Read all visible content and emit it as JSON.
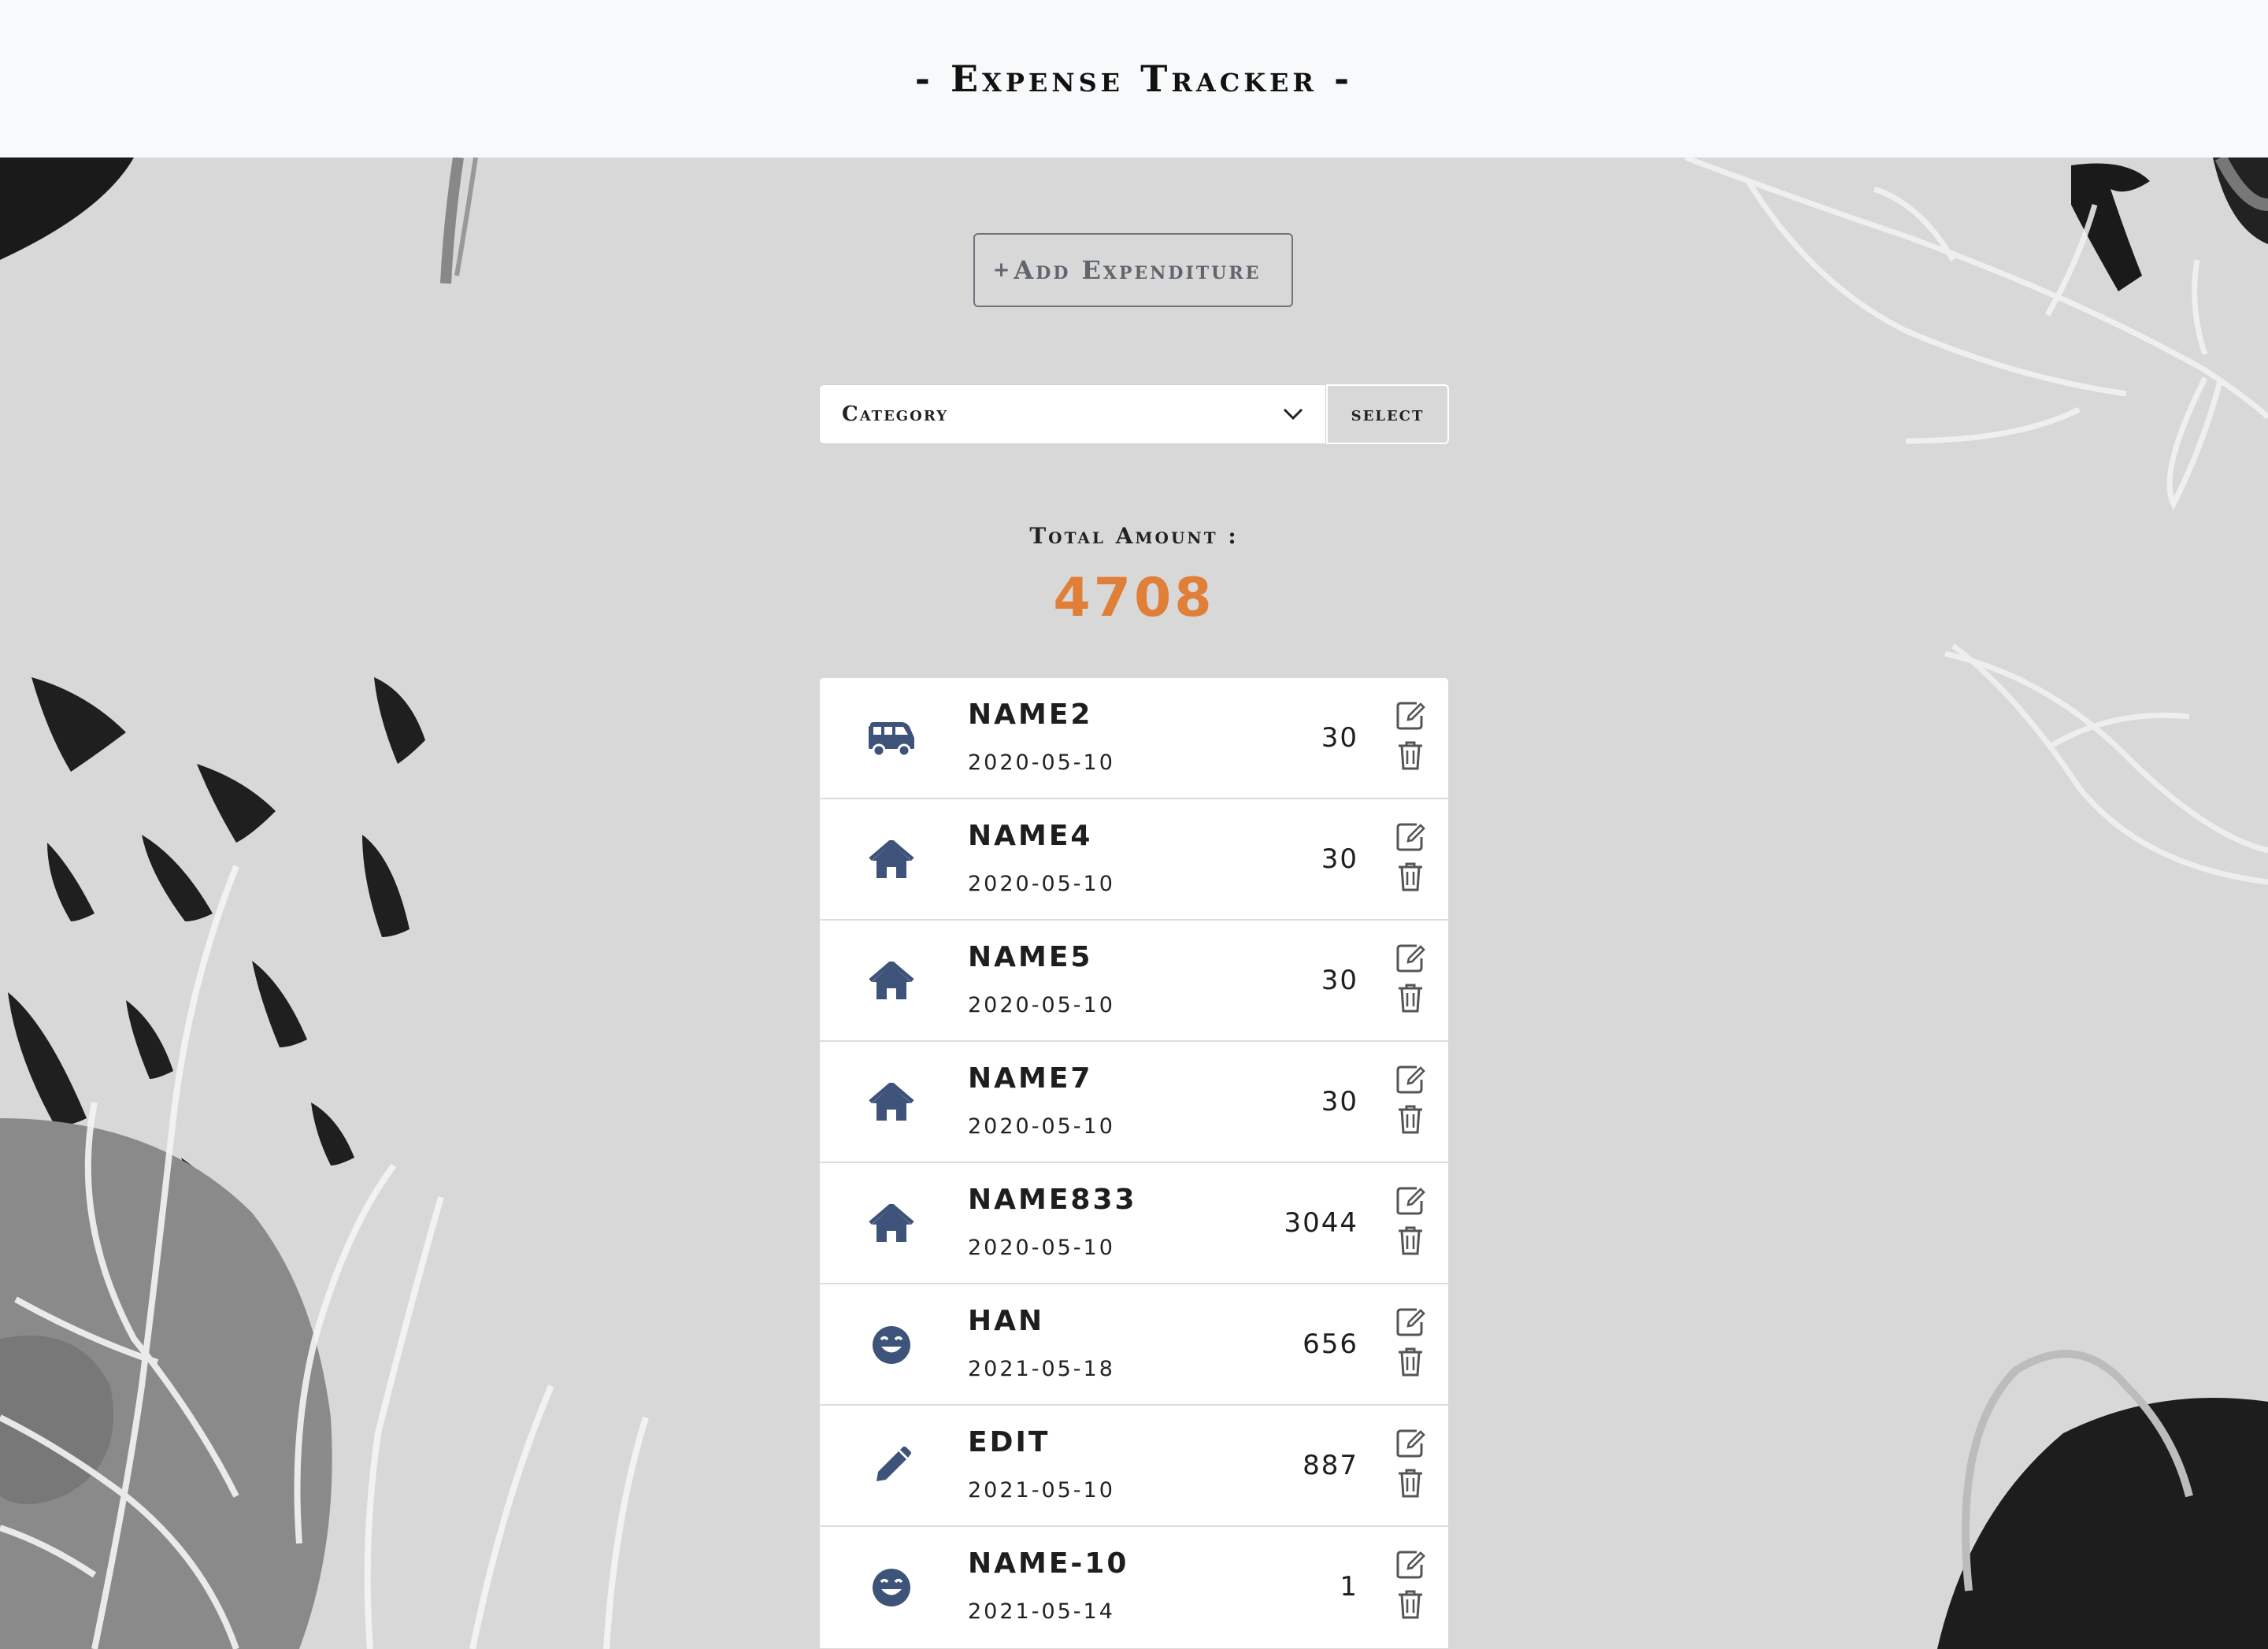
{
  "header": {
    "title": "- Expense Tracker -"
  },
  "toolbar": {
    "add_label": "Add Expenditure",
    "add_icon": "plus-icon"
  },
  "filter": {
    "category_value": "Category",
    "select_label": "select",
    "dropdown_icon": "chevron-down-icon"
  },
  "summary": {
    "total_label": "Total Amount :",
    "total_value": "4708"
  },
  "colors": {
    "accent": "#e07f38",
    "icon": "#3d5379",
    "header_bg": "#f8f9fa"
  },
  "expenses": [
    {
      "icon": "van-icon",
      "name": "NAME2",
      "date": "2020-05-10",
      "amount": "30"
    },
    {
      "icon": "home-icon",
      "name": "NAME4",
      "date": "2020-05-10",
      "amount": "30"
    },
    {
      "icon": "home-icon",
      "name": "NAME5",
      "date": "2020-05-10",
      "amount": "30"
    },
    {
      "icon": "home-icon",
      "name": "NAME7",
      "date": "2020-05-10",
      "amount": "30"
    },
    {
      "icon": "home-icon",
      "name": "NAME833",
      "date": "2020-05-10",
      "amount": "3044"
    },
    {
      "icon": "smile-icon",
      "name": "HAN",
      "date": "2021-05-18",
      "amount": "656"
    },
    {
      "icon": "pencil-icon",
      "name": "EDIT",
      "date": "2021-05-10",
      "amount": "887"
    },
    {
      "icon": "smile-icon",
      "name": "NAME-10",
      "date": "2021-05-14",
      "amount": "1"
    }
  ]
}
